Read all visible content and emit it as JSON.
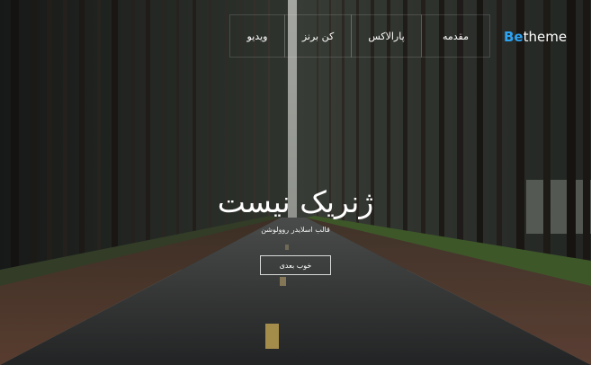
{
  "nav": {
    "items": [
      {
        "label": "ویدیو"
      },
      {
        "label": "کن برنز"
      },
      {
        "label": "پارالاکس"
      },
      {
        "label": "مقدمه"
      }
    ]
  },
  "logo": {
    "be": "Be",
    "theme": "theme"
  },
  "hero": {
    "title": "ژنریک نیست",
    "subtitle": "قالب اسلایدر روولوشن",
    "button_label": "خوب بعدی"
  },
  "colors": {
    "accent": "#2ea3f2",
    "text": "#ffffff"
  }
}
